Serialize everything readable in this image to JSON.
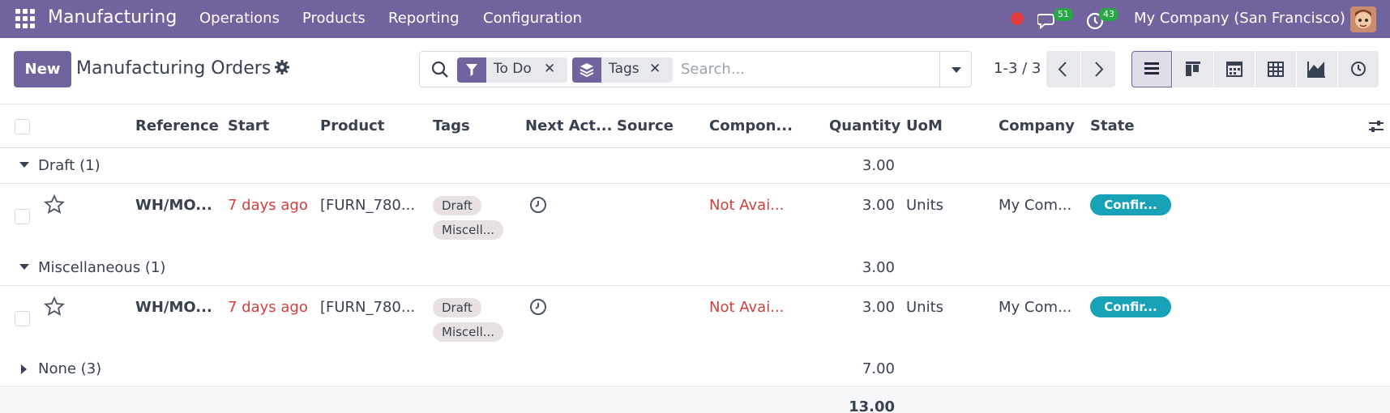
{
  "navbar": {
    "app_name": "Manufacturing",
    "menu": [
      "Operations",
      "Products",
      "Reporting",
      "Configuration"
    ],
    "chat_badge": "51",
    "activity_badge": "43",
    "company": "My Company (San Francisco)",
    "brand_color": "#71639e"
  },
  "control": {
    "new_label": "New",
    "title": "Manufacturing Orders",
    "facets": [
      {
        "label": "To Do",
        "icon": "filter-icon"
      },
      {
        "label": "Tags",
        "icon": "layers-icon"
      }
    ],
    "search_placeholder": "Search...",
    "pager": "1-3 / 3",
    "views": [
      "list-view-icon",
      "kanban-view-icon",
      "calendar-view-icon",
      "pivot-view-icon",
      "graph-view-icon",
      "activity-view-icon"
    ]
  },
  "table": {
    "columns": [
      "Reference",
      "Start",
      "Product",
      "Tags",
      "Next Act...",
      "Source",
      "Compon...",
      "Quantity",
      "UoM",
      "Company",
      "State"
    ],
    "groups": [
      {
        "label": "Draft (1)",
        "quantity": "3.00",
        "expanded": true,
        "rows": [
          {
            "reference": "WH/MO...",
            "start": "7 days ago",
            "product": "[FURN_780...",
            "tags": [
              "Draft",
              "Miscell..."
            ],
            "component": "Not Avai...",
            "quantity": "3.00",
            "uom": "Units",
            "company": "My Com...",
            "state": "Confir..."
          }
        ]
      },
      {
        "label": "Miscellaneous (1)",
        "quantity": "3.00",
        "expanded": true,
        "rows": [
          {
            "reference": "WH/MO...",
            "start": "7 days ago",
            "product": "[FURN_780...",
            "tags": [
              "Draft",
              "Miscell..."
            ],
            "component": "Not Avai...",
            "quantity": "3.00",
            "uom": "Units",
            "company": "My Com...",
            "state": "Confir..."
          }
        ]
      },
      {
        "label": "None (3)",
        "quantity": "7.00",
        "expanded": false,
        "rows": []
      }
    ],
    "total": "13.00"
  }
}
